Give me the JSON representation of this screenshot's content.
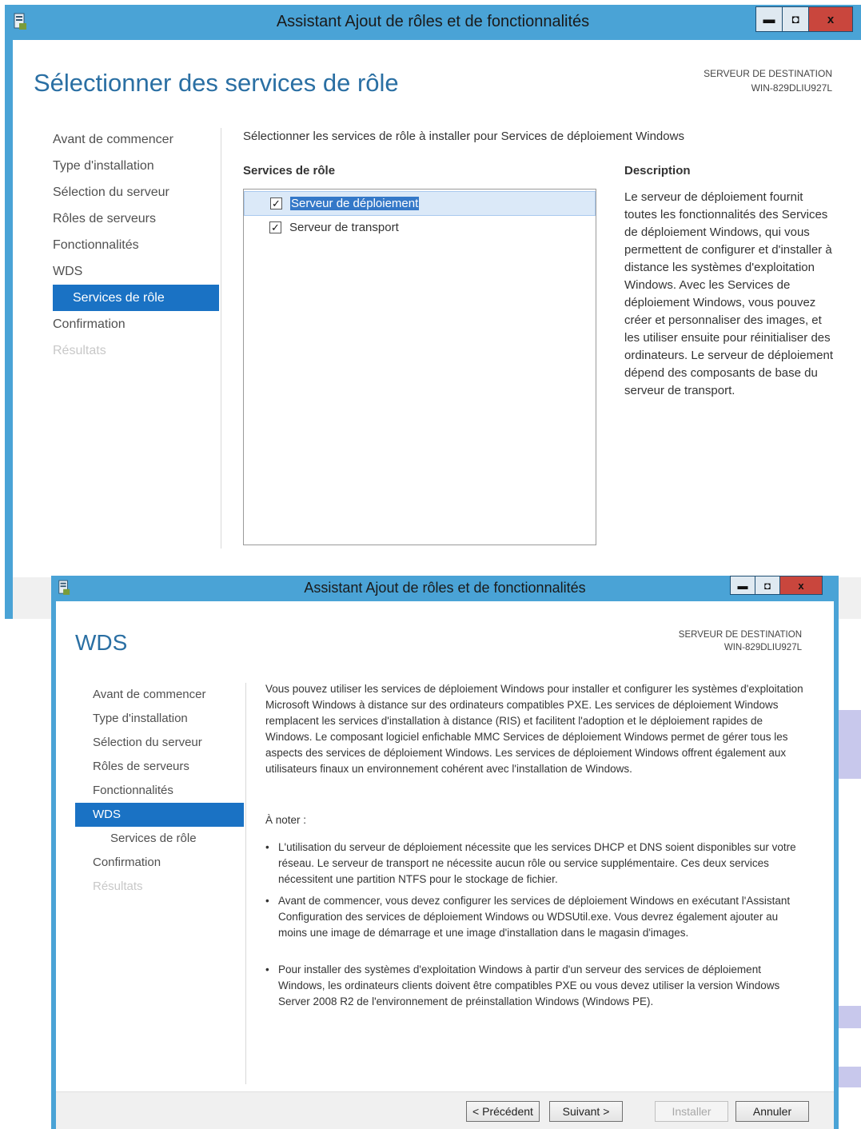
{
  "window_back": {
    "title": "Assistant Ajout de rôles et de fonctionnalités",
    "controls": {
      "minimize": "▬",
      "maximize": "◘",
      "close": "x"
    },
    "page_title": "Sélectionner des services de rôle",
    "destination": {
      "label": "SERVEUR DE DESTINATION",
      "server": "WIN-829DLIU927L"
    },
    "nav": [
      {
        "label": "Avant de commencer"
      },
      {
        "label": "Type d'installation"
      },
      {
        "label": "Sélection du serveur"
      },
      {
        "label": "Rôles de serveurs"
      },
      {
        "label": "Fonctionnalités"
      },
      {
        "label": "WDS"
      },
      {
        "label": "Services de rôle"
      },
      {
        "label": "Confirmation"
      },
      {
        "label": "Résultats"
      }
    ],
    "intro": "Sélectionner les services de rôle à installer pour Services de déploiement Windows",
    "roles_header": "Services de rôle",
    "roles": [
      {
        "label": "Serveur de déploiement",
        "checked": true
      },
      {
        "label": "Serveur de transport",
        "checked": true
      }
    ],
    "description_header": "Description",
    "description": "Le serveur de déploiement fournit toutes les fonctionnalités des Services de déploiement Windows, qui vous permettent de configurer et d'installer à distance les systèmes d'exploitation Windows. Avec les Services de déploiement Windows, vous pouvez créer et personnaliser des images, et les utiliser ensuite pour réinitialiser des ordinateurs. Le serveur de déploiement dépend des composants de base du serveur de transport."
  },
  "window_front": {
    "title": "Assistant Ajout de rôles et de fonctionnalités",
    "controls": {
      "minimize": "▬",
      "maximize": "◘",
      "close": "x"
    },
    "page_title": "WDS",
    "destination": {
      "label": "SERVEUR DE DESTINATION",
      "server": "WIN-829DLIU927L"
    },
    "nav": [
      {
        "label": "Avant de commencer"
      },
      {
        "label": "Type d'installation"
      },
      {
        "label": "Sélection du serveur"
      },
      {
        "label": "Rôles de serveurs"
      },
      {
        "label": "Fonctionnalités"
      },
      {
        "label": "WDS"
      },
      {
        "label": "Services de rôle"
      },
      {
        "label": "Confirmation"
      },
      {
        "label": "Résultats"
      }
    ],
    "intro": "Vous pouvez utiliser les services de déploiement Windows pour installer et configurer les systèmes d'exploitation Microsoft Windows à distance sur des ordinateurs compatibles PXE. Les services de déploiement Windows remplacent les services d'installation à distance (RIS) et facilitent l'adoption et le déploiement rapides de Windows. Le composant logiciel enfichable MMC Services de déploiement Windows permet de gérer tous les aspects des services de déploiement Windows. Les services de déploiement Windows offrent également aux utilisateurs finaux un environnement cohérent avec l'installation de Windows.",
    "note_label": "À noter :",
    "bullets": [
      "L'utilisation du serveur de déploiement nécessite que les services DHCP et DNS soient disponibles sur votre réseau. Le serveur de transport ne nécessite aucun rôle ou service supplémentaire. Ces deux services nécessitent une partition NTFS pour le stockage de fichier.",
      "Avant de commencer, vous devez configurer les services de déploiement Windows en exécutant l'Assistant Configuration des services de déploiement Windows ou WDSUtil.exe. Vous devrez également ajouter au moins une image de démarrage et une image d'installation dans le magasin d'images.",
      "Pour installer des systèmes d'exploitation Windows à partir d'un serveur des services de déploiement Windows, les ordinateurs clients doivent être compatibles PXE ou vous devez utiliser la version Windows Server 2008 R2 de l'environnement de préinstallation Windows (Windows PE)."
    ],
    "buttons": {
      "previous": "< Précédent",
      "next": "Suivant >",
      "install": "Installer",
      "cancel": "Annuler"
    }
  },
  "colors": {
    "frame": "#4aa3d6",
    "accent_title": "#2a6fa3",
    "nav_selected": "#1a72c4",
    "close_button": "#c9463d"
  }
}
